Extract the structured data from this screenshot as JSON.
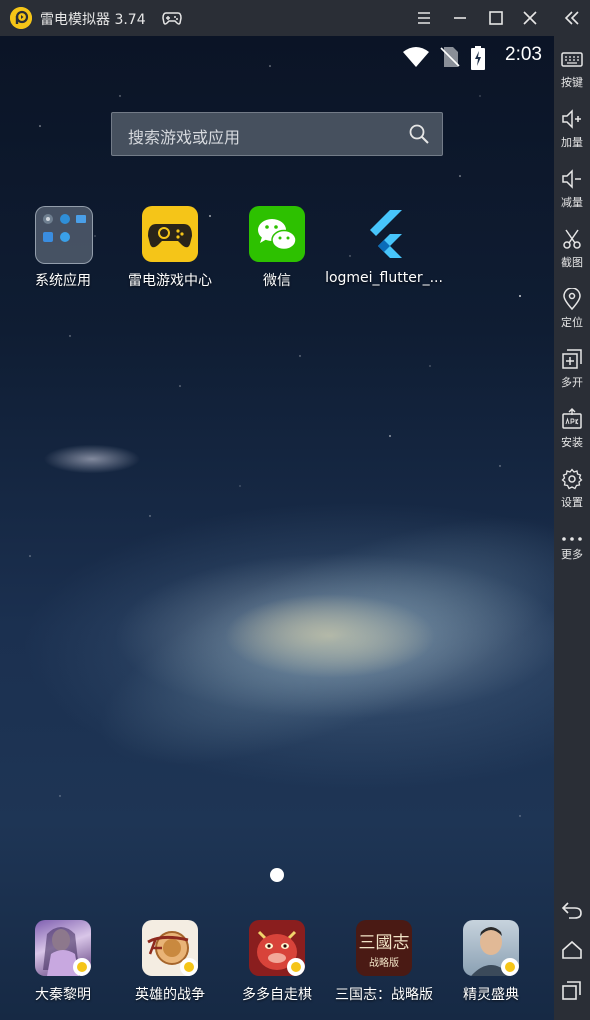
{
  "window": {
    "title": "雷电模拟器 3.74",
    "controls": [
      "menu-icon",
      "minimize-icon",
      "maximize-icon",
      "close-icon"
    ],
    "collapse_icon": "double-chevron-left-icon"
  },
  "status_bar": {
    "time": "2:03",
    "icons": [
      "wifi-icon",
      "no-sim-icon",
      "battery-charging-icon"
    ]
  },
  "search": {
    "placeholder": "搜索游戏或应用",
    "icon": "search-icon"
  },
  "home_apps": [
    {
      "label": "系统应用",
      "icon": "system-apps-folder-icon"
    },
    {
      "label": "雷电游戏中心",
      "icon": "gamepad-icon",
      "color": "#f5c518"
    },
    {
      "label": "微信",
      "icon": "wechat-icon",
      "color": "#2dc100"
    },
    {
      "label": "logmei_flutter_...",
      "icon": "flutter-icon",
      "color": "#47c5fb"
    }
  ],
  "dock_apps": [
    {
      "label": "大秦黎明",
      "icon": "daqin-game-icon"
    },
    {
      "label": "英雄的战争",
      "icon": "hero-war-game-icon"
    },
    {
      "label": "多多自走棋",
      "icon": "duoduo-chess-game-icon"
    },
    {
      "label": "三国志：战略版",
      "icon": "three-kingdoms-game-icon",
      "icon_text": "三國志",
      "icon_subtext": "战略版"
    },
    {
      "label": "精灵盛典",
      "icon": "elf-ceremony-game-icon"
    }
  ],
  "sidebar": {
    "items": [
      {
        "label": "按键",
        "icon": "keyboard-icon"
      },
      {
        "label": "加量",
        "icon": "volume-up-icon"
      },
      {
        "label": "减量",
        "icon": "volume-down-icon"
      },
      {
        "label": "截图",
        "icon": "scissors-icon"
      },
      {
        "label": "定位",
        "icon": "location-icon"
      },
      {
        "label": "多开",
        "icon": "multi-instance-icon"
      },
      {
        "label": "安装",
        "icon": "apk-install-icon"
      },
      {
        "label": "设置",
        "icon": "gear-icon"
      },
      {
        "label": "更多",
        "icon": "more-icon"
      }
    ],
    "nav": [
      "back-icon",
      "home-icon",
      "recents-icon"
    ]
  },
  "colors": {
    "chrome": "#2a2e36",
    "accent": "#f5c518"
  }
}
